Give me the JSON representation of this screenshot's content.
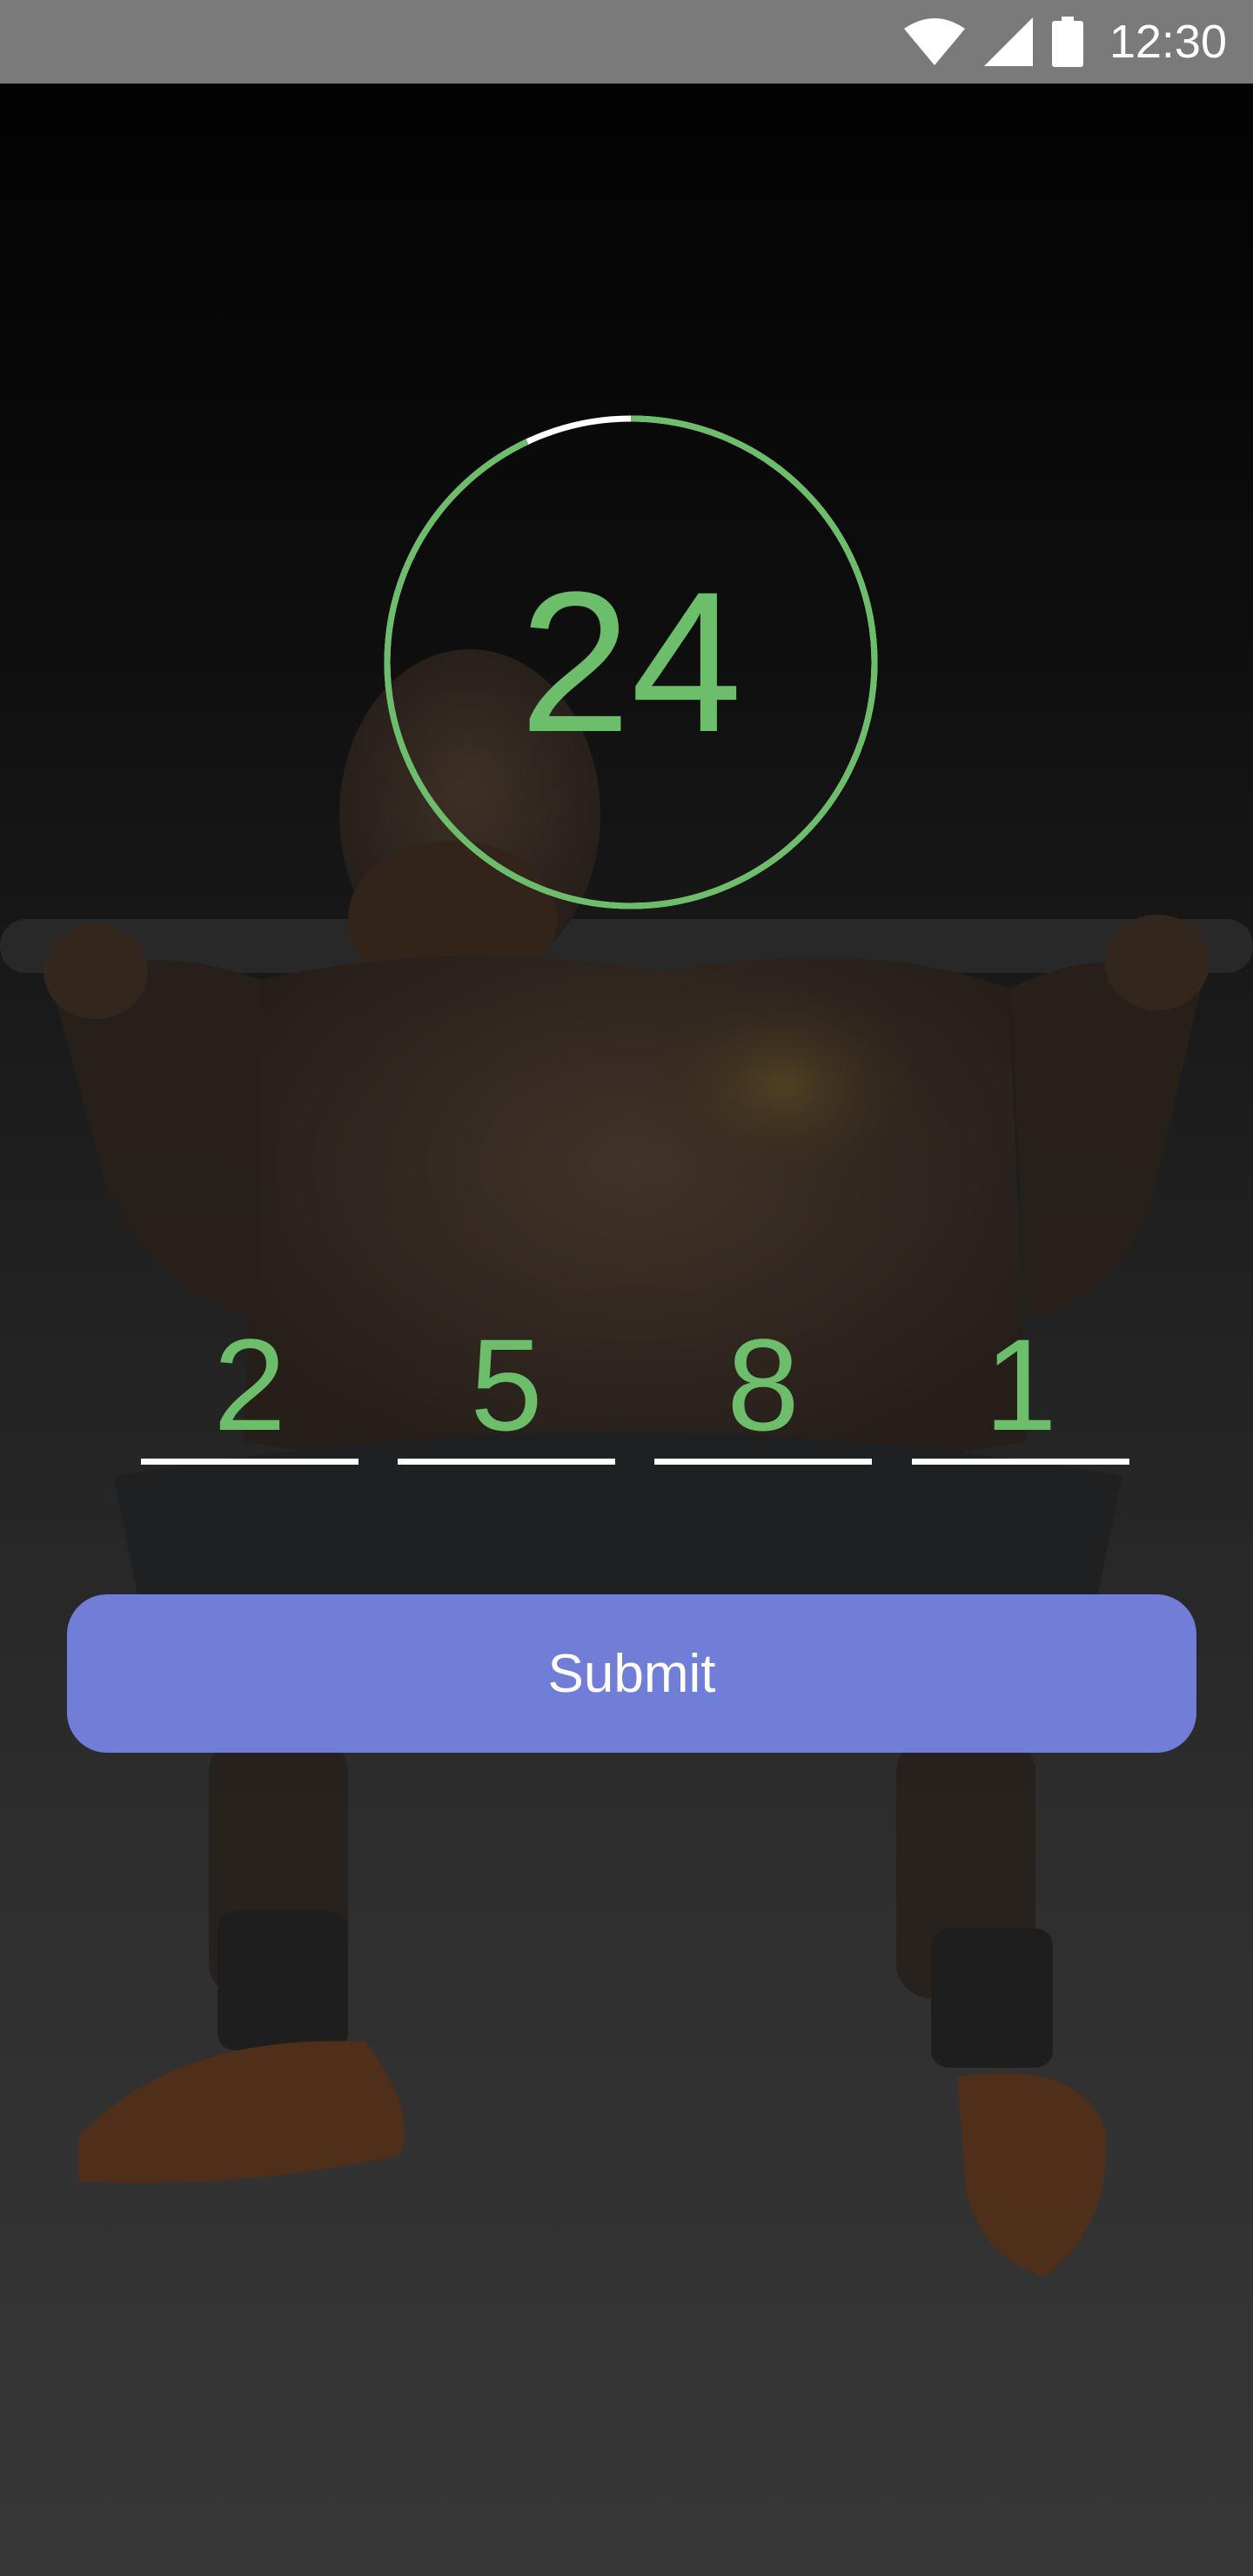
{
  "status_bar": {
    "time": "12:30",
    "icons": [
      "wifi-icon",
      "cellular-signal-icon",
      "battery-icon"
    ]
  },
  "timer": {
    "value": "24",
    "progress_fraction": 0.93,
    "ring_color": "#6dbe6a",
    "remaining_color": "#ffffff"
  },
  "code": {
    "digits": [
      "2",
      "5",
      "8",
      "1"
    ],
    "digit_color": "#6dbe6a"
  },
  "submit": {
    "label": "Submit",
    "color": "#707ed7"
  },
  "background": {
    "image": "weightlifter-squat-photo"
  }
}
